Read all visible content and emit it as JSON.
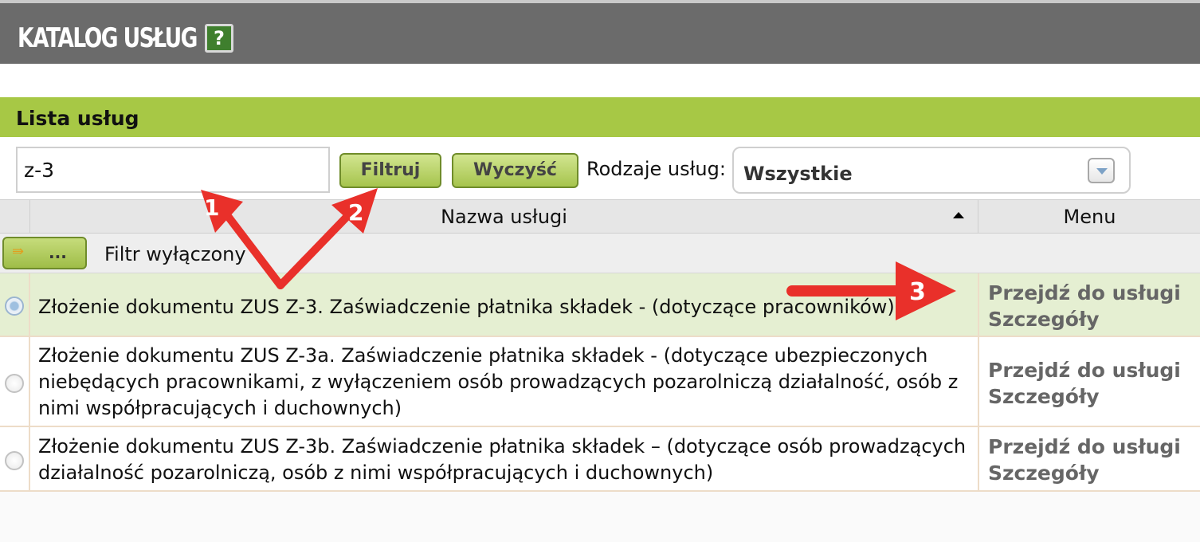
{
  "header": {
    "title": "KATALOG USŁUG",
    "help_label": "?"
  },
  "panel": {
    "title": "Lista usług"
  },
  "filter": {
    "search_value": "z-3",
    "filter_button": "Filtruj",
    "clear_button": "Wyczyść",
    "types_label": "Rodzaje usług:",
    "types_value": "Wszystkie"
  },
  "table": {
    "columns": {
      "name": "Nazwa usługi",
      "menu": "Menu"
    },
    "filter_button_label": "...",
    "filter_status": "Filtr wyłączony",
    "rows": [
      {
        "name": "Złożenie dokumentu ZUS Z-3. Zaświadczenie płatnika składek - (dotyczące pracowników)",
        "link1": "Przejdź do usługi",
        "link2": "Szczegóły"
      },
      {
        "name": "Złożenie dokumentu ZUS Z-3a. Zaświadczenie płatnika składek - (dotyczące ubezpieczonych niebędących pracownikami, z wyłączeniem osób prowadzących pozarolniczą działalność, osób z nimi współpracujących i duchownych)",
        "link1": "Przejdź do usługi",
        "link2": "Szczegóły"
      },
      {
        "name": "Złożenie dokumentu ZUS Z-3b. Zaświadczenie płatnika składek – (dotyczące osób prowadzących działalność pozarolniczą, osób z nimi współpracujących i duchownych)",
        "link1": "Przejdź do usługi",
        "link2": "Szczegóły"
      }
    ]
  },
  "annotations": {
    "label1": "1",
    "label2": "2",
    "label3": "3"
  },
  "colors": {
    "header_bg": "#6b6b6b",
    "panel_bar": "#a7c845",
    "selected_row": "#e5efd2",
    "arrow": "#e9302a"
  }
}
